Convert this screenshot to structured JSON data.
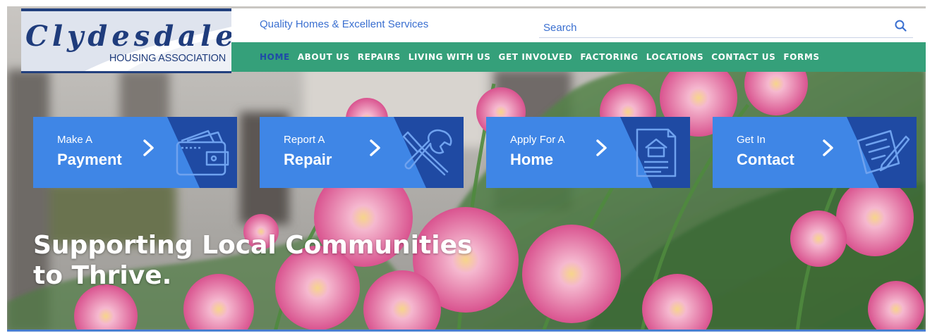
{
  "brand": {
    "script_name": "Clydesdale",
    "subtitle": "HOUSING ASSOCIATION",
    "tagline": "Quality Homes & Excellent Services"
  },
  "search": {
    "placeholder": "Search",
    "icon": "search-icon"
  },
  "nav": {
    "active_index": 0,
    "items": [
      {
        "label": "HOME"
      },
      {
        "label": "ABOUT US"
      },
      {
        "label": "REPAIRS"
      },
      {
        "label": "LIVING WITH US"
      },
      {
        "label": "GET INVOLVED"
      },
      {
        "label": "FACTORING"
      },
      {
        "label": "LOCATIONS"
      },
      {
        "label": "CONTACT US"
      },
      {
        "label": "FORMS"
      }
    ]
  },
  "quick_links": [
    {
      "small": "Make A",
      "big": "Payment",
      "icon": "wallet-icon"
    },
    {
      "small": "Report A",
      "big": "Repair",
      "icon": "tools-icon"
    },
    {
      "small": "Apply For A",
      "big": "Home",
      "icon": "house-document-icon"
    },
    {
      "small": "Get In",
      "big": "Contact",
      "icon": "pen-paper-icon"
    }
  ],
  "hero": {
    "headline_line1": "Supporting Local Communities",
    "headline_line2": "to Thrive."
  },
  "colors": {
    "brand_navy": "#1f3c7c",
    "nav_green": "#35a07a",
    "active_nav": "#1f4aa8",
    "card_blue": "#3f86e6",
    "card_dark": "#1f4aa3",
    "tagline_blue": "#3a6fd0"
  }
}
